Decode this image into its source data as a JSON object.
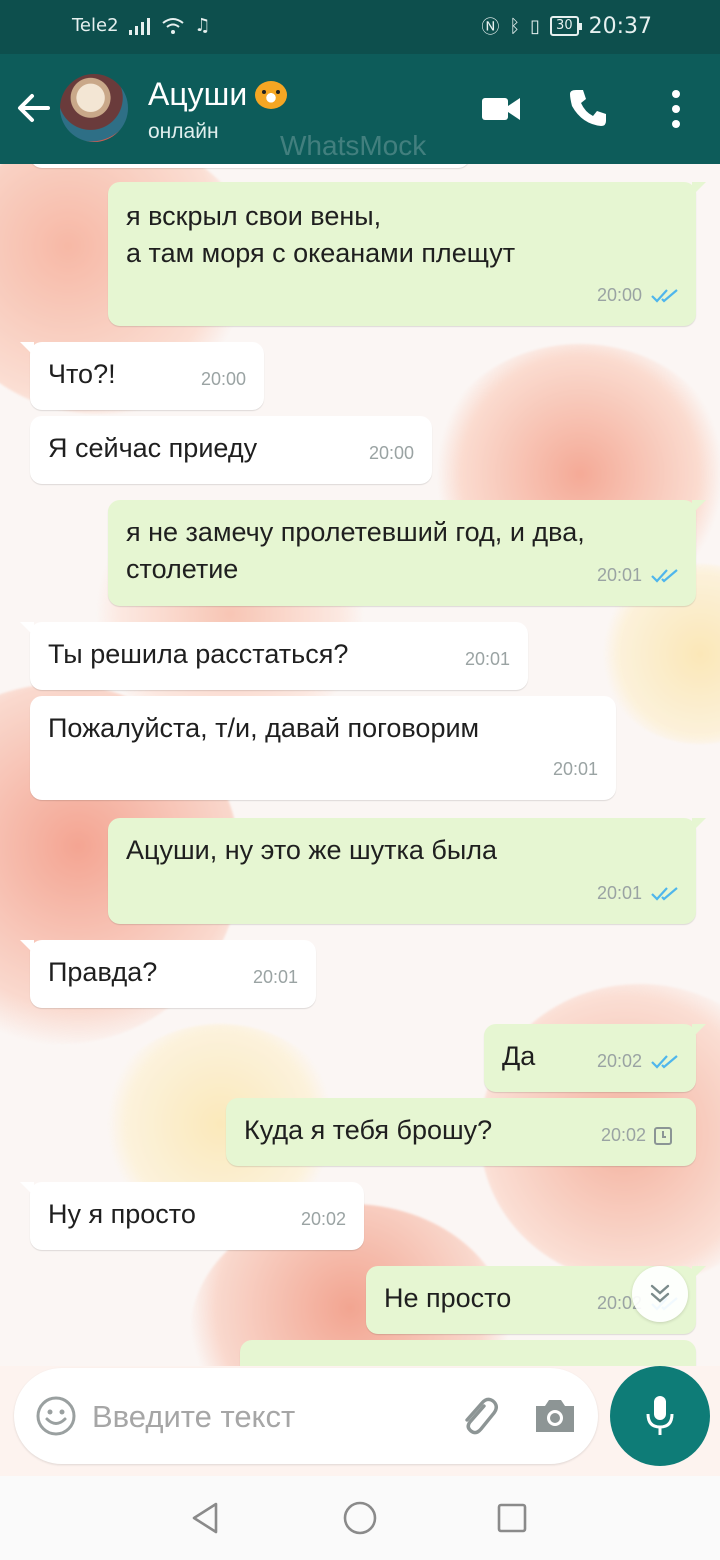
{
  "status_bar": {
    "carrier": "Tele2",
    "battery": "30",
    "time": "20:37"
  },
  "header": {
    "contact_name": "Ацуши",
    "contact_status": "онлайн",
    "watermark": "WhatsMock"
  },
  "messages": [
    {
      "side": "out",
      "text": "я вскрыл свои вены,\nа там моря с океанами плещут",
      "time": "20:00",
      "status": "read"
    },
    {
      "side": "in",
      "text": "Что?!",
      "time": "20:00"
    },
    {
      "side": "in",
      "text": "Я сейчас приеду",
      "time": "20:00"
    },
    {
      "side": "out",
      "text": "я не замечу пролетевший год, и два,\nстолетие",
      "time": "20:01",
      "status": "read"
    },
    {
      "side": "in",
      "text": "Ты решила расстаться?",
      "time": "20:01"
    },
    {
      "side": "in",
      "text": "Пожалуйста, т/и, давай поговорим",
      "time": "20:01"
    },
    {
      "side": "out",
      "text": "Ацуши, ну это же шутка была",
      "time": "20:01",
      "status": "read"
    },
    {
      "side": "in",
      "text": "Правда?",
      "time": "20:01"
    },
    {
      "side": "out",
      "text": "Да",
      "time": "20:02",
      "status": "read"
    },
    {
      "side": "out",
      "text": "Куда я тебя брошу?",
      "time": "20:02",
      "status": "pending"
    },
    {
      "side": "in",
      "text": "Ну я просто",
      "time": "20:02"
    },
    {
      "side": "out",
      "text": "Не просто",
      "time": "20:02",
      "status": "read"
    }
  ],
  "composer": {
    "placeholder": "Введите текст"
  },
  "colors": {
    "header": "#0d5c5a",
    "status_bar": "#0d4f4d",
    "outgoing_bubble": "#e6f6d2",
    "incoming_bubble": "#ffffff",
    "read_ticks": "#4fb6ec",
    "mic_button": "#0e7c77"
  }
}
